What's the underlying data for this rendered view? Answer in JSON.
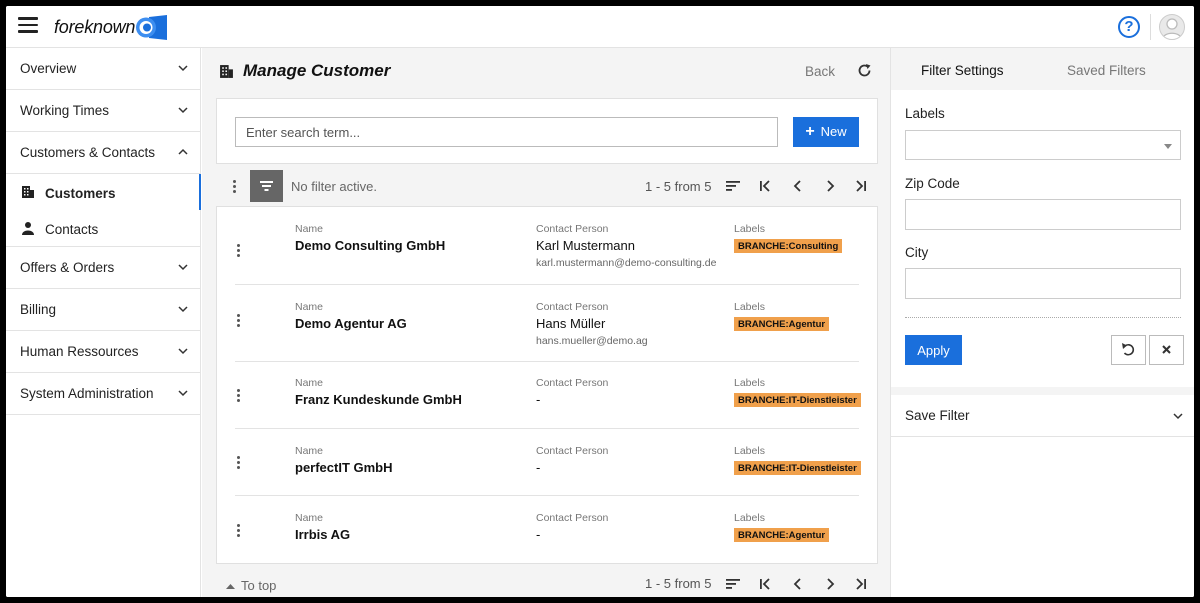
{
  "header": {
    "app_name": "foreknown",
    "help_icon": "help-circle-icon",
    "avatar_icon": "user-avatar-icon",
    "accent_color": "#1a6fdc"
  },
  "sidebar": {
    "groups": [
      {
        "label": "Overview",
        "state": "collapsed"
      },
      {
        "label": "Working Times",
        "state": "collapsed"
      },
      {
        "label": "Customers & Contacts",
        "state": "expanded"
      },
      {
        "label": "Offers & Orders",
        "state": "collapsed"
      },
      {
        "label": "Billing",
        "state": "collapsed"
      },
      {
        "label": "Human Ressources",
        "state": "collapsed"
      },
      {
        "label": "System Administration",
        "state": "collapsed"
      }
    ],
    "subitems": [
      {
        "label": "Customers",
        "icon": "building-icon",
        "active": true
      },
      {
        "label": "Contacts",
        "icon": "person-icon",
        "active": false
      }
    ]
  },
  "main": {
    "title": "Manage Customer",
    "title_icon": "building-icon",
    "back_label": "Back",
    "search": {
      "placeholder": "Enter search term...",
      "value": ""
    },
    "new_label": "New",
    "filter_status": "No filter active.",
    "pager_text": "1 - 5 from 5",
    "to_top_label": "To top",
    "columns": {
      "name": "Name",
      "contact": "Contact Person",
      "labels": "Labels"
    },
    "rows": [
      {
        "name": "Demo Consulting GmbH",
        "contact": "Karl Mustermann",
        "email": "karl.mustermann@demo-consulting.de",
        "label": "BRANCHE:Consulting"
      },
      {
        "name": "Demo Agentur AG",
        "contact": "Hans Müller",
        "email": "hans.mueller@demo.ag",
        "label": "BRANCHE:Agentur"
      },
      {
        "name": "Franz Kundeskunde GmbH",
        "contact": "-",
        "email": "",
        "label": "BRANCHE:IT-Dienstleister"
      },
      {
        "name": "perfectIT GmbH",
        "contact": "-",
        "email": "",
        "label": "BRANCHE:IT-Dienstleister"
      },
      {
        "name": "Irrbis AG",
        "contact": "-",
        "email": "",
        "label": "BRANCHE:Agentur"
      }
    ],
    "tag_color": "#f0a04b"
  },
  "filter_panel": {
    "tabs": [
      {
        "label": "Filter Settings",
        "active": true
      },
      {
        "label": "Saved Filters",
        "active": false
      }
    ],
    "fields": {
      "labels": {
        "label": "Labels",
        "value": ""
      },
      "zip": {
        "label": "Zip Code",
        "value": ""
      },
      "city": {
        "label": "City",
        "value": ""
      }
    },
    "apply_label": "Apply",
    "save_filter_label": "Save Filter"
  }
}
